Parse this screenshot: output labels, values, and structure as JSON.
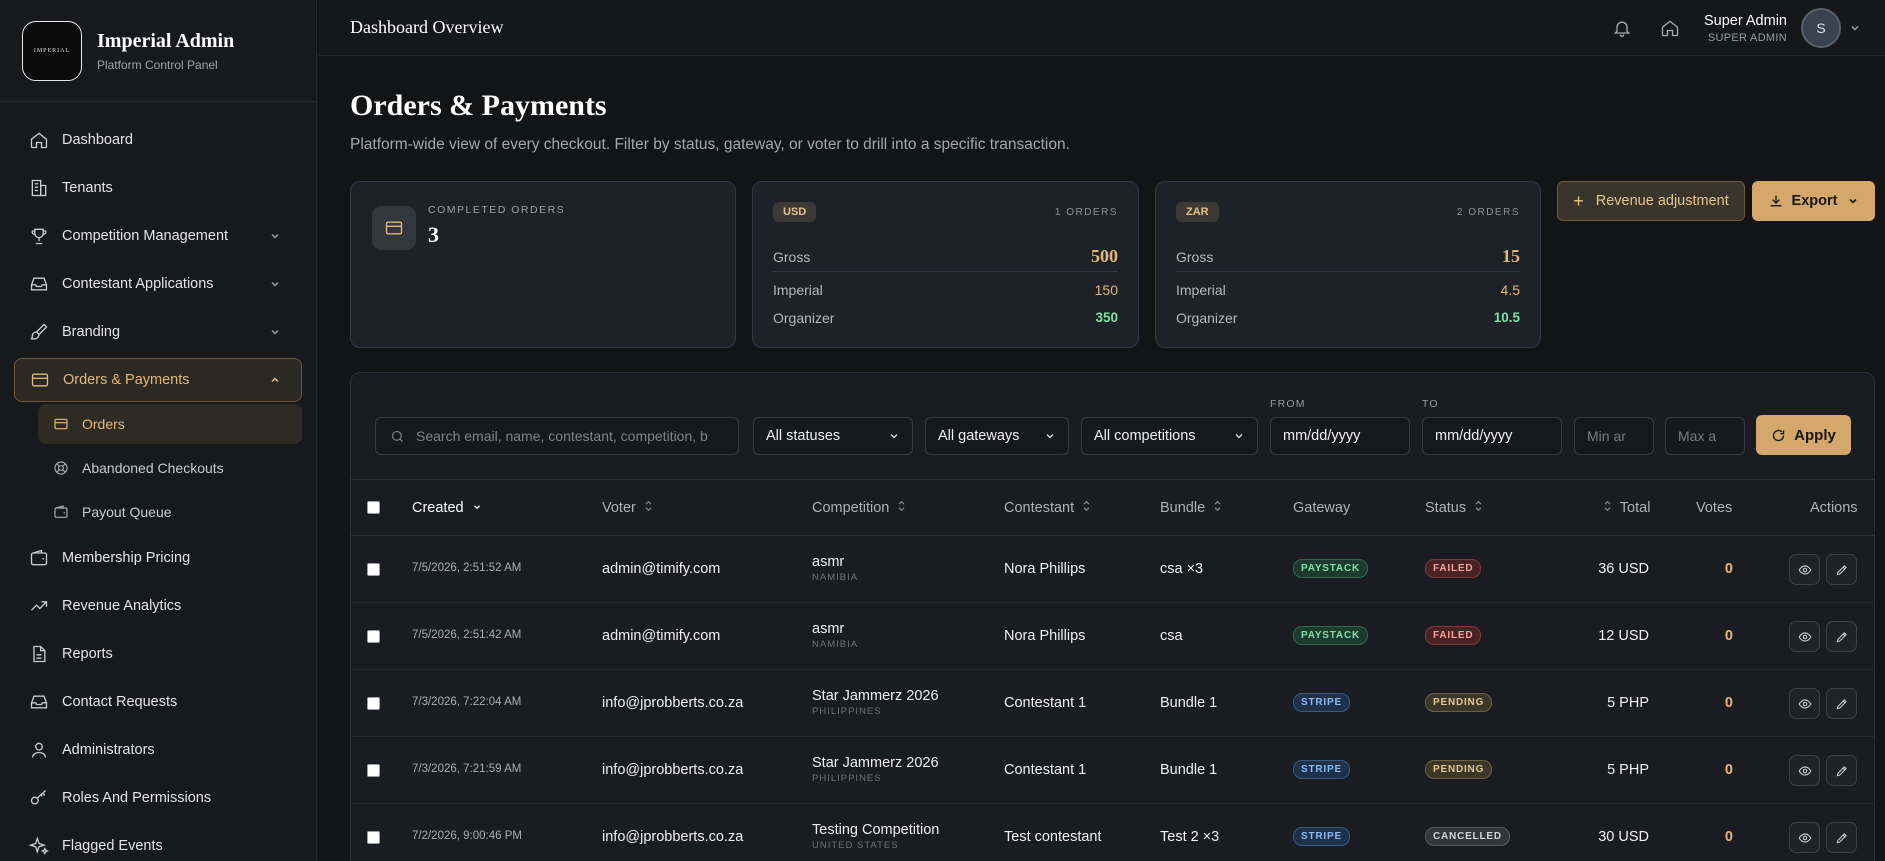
{
  "sidebar": {
    "logo_text": "IMPERIAL",
    "brand_title": "Imperial Admin",
    "brand_subtitle": "Platform Control Panel",
    "items": [
      {
        "label": "Dashboard"
      },
      {
        "label": "Tenants"
      },
      {
        "label": "Competition Management"
      },
      {
        "label": "Contestant Applications"
      },
      {
        "label": "Branding"
      },
      {
        "label": "Orders & Payments"
      },
      {
        "label": "Membership Pricing"
      },
      {
        "label": "Revenue Analytics"
      },
      {
        "label": "Reports"
      },
      {
        "label": "Contact Requests"
      },
      {
        "label": "Administrators"
      },
      {
        "label": "Roles And Permissions"
      },
      {
        "label": "Flagged Events"
      }
    ],
    "sub_items": [
      {
        "label": "Orders"
      },
      {
        "label": "Abandoned Checkouts"
      },
      {
        "label": "Payout Queue"
      }
    ]
  },
  "topbar": {
    "title": "Dashboard Overview",
    "user_name": "Super Admin",
    "user_role": "SUPER ADMIN",
    "avatar_initial": "S"
  },
  "page": {
    "title": "Orders & Payments",
    "subtitle": "Platform-wide view of every checkout. Filter by status, gateway, or voter to drill into a specific transaction."
  },
  "summary": {
    "completed_label": "COMPLETED ORDERS",
    "completed_value": "3",
    "currencies": [
      {
        "code": "USD",
        "orders": "1 ORDERS",
        "gross_label": "Gross",
        "gross": "500",
        "imperial_label": "Imperial",
        "imperial": "150",
        "organizer_label": "Organizer",
        "organizer": "350"
      },
      {
        "code": "ZAR",
        "orders": "2 ORDERS",
        "gross_label": "Gross",
        "gross": "15",
        "imperial_label": "Imperial",
        "imperial": "4.5",
        "organizer_label": "Organizer",
        "organizer": "10.5"
      }
    ]
  },
  "actions": {
    "revenue_adjustment": "Revenue adjustment",
    "export": "Export"
  },
  "filters": {
    "search_placeholder": "Search email, name, contestant, competition, b",
    "status": "All statuses",
    "gateway": "All gateways",
    "competition": "All competitions",
    "from_label": "FROM",
    "to_label": "TO",
    "from_value": "mm/dd/yyyy",
    "to_value": "mm/dd/yyyy",
    "min_placeholder": "Min ar",
    "max_placeholder": "Max a",
    "apply": "Apply"
  },
  "table": {
    "columns": [
      "Created",
      "Voter",
      "Competition",
      "Contestant",
      "Bundle",
      "Gateway",
      "Status",
      "Total",
      "Votes",
      "Actions"
    ],
    "rows": [
      {
        "created": "7/5/2026, 2:51:52 AM",
        "voter": "admin@timify.com",
        "competition": "asmr",
        "country": "NAMIBIA",
        "contestant": "Nora Phillips",
        "bundle": "csa ×3",
        "gateway": "PAYSTACK",
        "status": "FAILED",
        "total": "36 USD",
        "votes": "0"
      },
      {
        "created": "7/5/2026, 2:51:42 AM",
        "voter": "admin@timify.com",
        "competition": "asmr",
        "country": "NAMIBIA",
        "contestant": "Nora Phillips",
        "bundle": "csa",
        "gateway": "PAYSTACK",
        "status": "FAILED",
        "total": "12 USD",
        "votes": "0"
      },
      {
        "created": "7/3/2026, 7:22:04 AM",
        "voter": "info@jprobberts.co.za",
        "competition": "Star Jammerz 2026",
        "country": "PHILIPPINES",
        "contestant": "Contestant 1",
        "bundle": "Bundle 1",
        "gateway": "STRIPE",
        "status": "PENDING",
        "total": "5 PHP",
        "votes": "0"
      },
      {
        "created": "7/3/2026, 7:21:59 AM",
        "voter": "info@jprobberts.co.za",
        "competition": "Star Jammerz 2026",
        "country": "PHILIPPINES",
        "contestant": "Contestant 1",
        "bundle": "Bundle 1",
        "gateway": "STRIPE",
        "status": "PENDING",
        "total": "5 PHP",
        "votes": "0"
      },
      {
        "created": "7/2/2026, 9:00:46 PM",
        "voter": "info@jprobberts.co.za",
        "competition": "Testing Competition",
        "country": "UNITED STATES",
        "contestant": "Test contestant",
        "bundle": "Test 2 ×3",
        "gateway": "STRIPE",
        "status": "CANCELLED",
        "total": "30 USD",
        "votes": "0"
      }
    ]
  },
  "colors": {
    "accent": "#d3a86a",
    "background": "#131416",
    "success": "#7ee2a4"
  },
  "icons": [
    "home-icon",
    "building-icon",
    "trophy-icon",
    "inbox-icon",
    "brush-icon",
    "credit-card-icon",
    "wallet-icon",
    "trending-up-icon",
    "file-icon",
    "mail-icon",
    "user-icon",
    "key-icon",
    "sparkle-icon",
    "bell-icon",
    "eye-icon",
    "pencil-icon",
    "search-icon",
    "refresh-icon",
    "download-icon",
    "plus-icon"
  ]
}
